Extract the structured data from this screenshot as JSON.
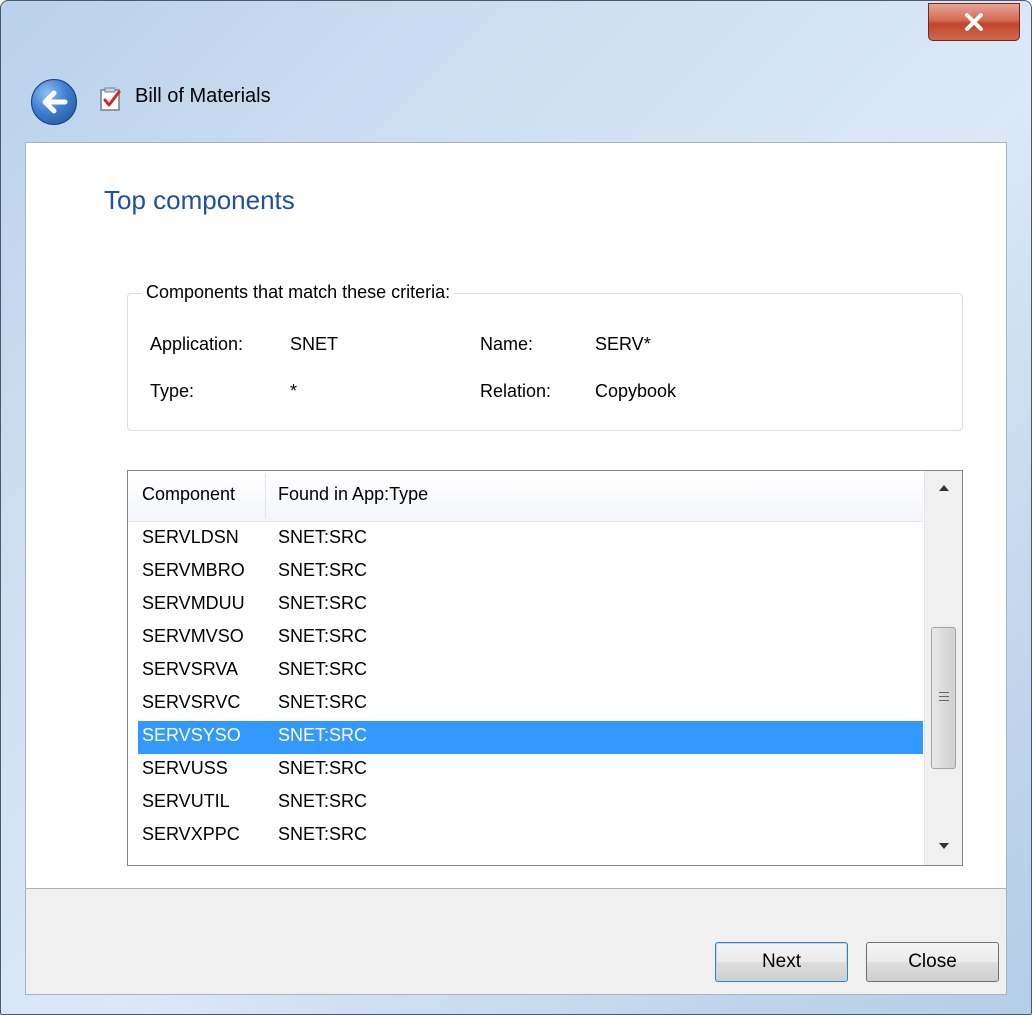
{
  "window": {
    "title": "Bill of Materials",
    "icons": {
      "back": "back-arrow-icon",
      "title": "checklist-document-icon",
      "close": "close-x-icon"
    }
  },
  "page": {
    "title": "Top components"
  },
  "criteria": {
    "legend": "Components that match these criteria:",
    "application_label": "Application:",
    "application_value": "SNET",
    "name_label": "Name:",
    "name_value": "SERV*",
    "type_label": "Type:",
    "type_value": "*",
    "relation_label": "Relation:",
    "relation_value": "Copybook"
  },
  "list": {
    "columns": [
      "Component",
      "Found in App:Type"
    ],
    "rows": [
      {
        "component": "SERVLDSN",
        "found": "SNET:SRC"
      },
      {
        "component": "SERVMBRO",
        "found": "SNET:SRC"
      },
      {
        "component": "SERVMDUU",
        "found": "SNET:SRC"
      },
      {
        "component": "SERVMVSO",
        "found": "SNET:SRC"
      },
      {
        "component": "SERVSRVA",
        "found": "SNET:SRC"
      },
      {
        "component": "SERVSRVC",
        "found": "SNET:SRC"
      },
      {
        "component": "SERVSYSO",
        "found": "SNET:SRC"
      },
      {
        "component": "SERVUSS",
        "found": "SNET:SRC"
      },
      {
        "component": "SERVUTIL",
        "found": "SNET:SRC"
      },
      {
        "component": "SERVXPPC",
        "found": "SNET:SRC"
      }
    ],
    "selected_index": 6
  },
  "buttons": {
    "next": "Next",
    "close": "Close"
  },
  "colors": {
    "selection": "#3399ff",
    "title_blue": "#1f4f9f",
    "close_red": "#c1452c"
  }
}
